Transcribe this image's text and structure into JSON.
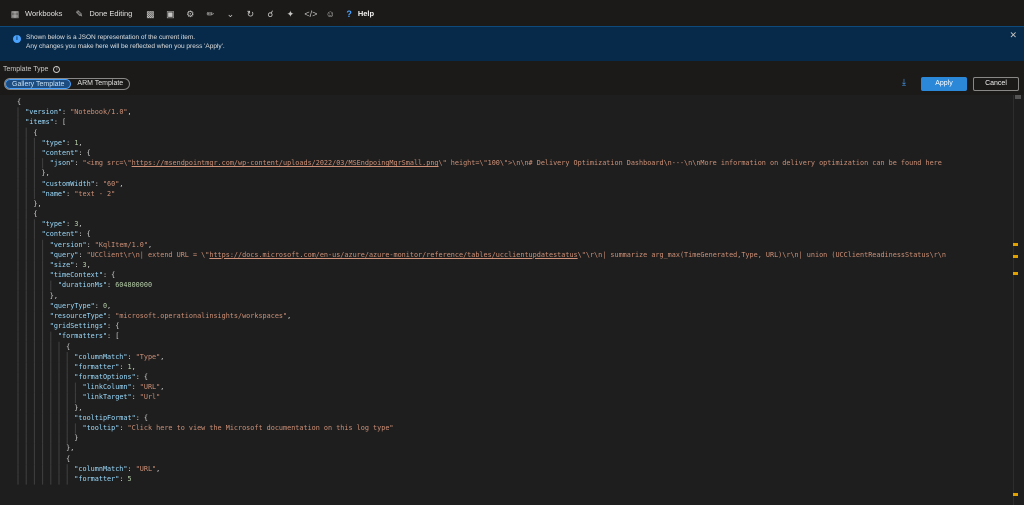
{
  "toolbar": {
    "workbooks_label": "Workbooks",
    "done_editing_label": "Done Editing",
    "help_label": "Help"
  },
  "banner": {
    "line1": "Shown below is a JSON representation of the current item.",
    "line2": "Any changes you make here will be reflected when you press 'Apply'."
  },
  "template_type": {
    "label": "Template Type",
    "options": [
      "Gallery Template",
      "ARM Template"
    ],
    "selected": "Gallery Template"
  },
  "actions": {
    "apply": "Apply",
    "cancel": "Cancel"
  },
  "editor": {
    "lines": [
      [
        [
          "p",
          "{"
        ]
      ],
      [
        [
          "p",
          "  "
        ],
        [
          "k",
          "\"version\""
        ],
        [
          "p",
          ": "
        ],
        [
          "s",
          "\"Notebook/1.0\""
        ],
        [
          "p",
          ","
        ]
      ],
      [
        [
          "p",
          "  "
        ],
        [
          "k",
          "\"items\""
        ],
        [
          "p",
          ": ["
        ]
      ],
      [
        [
          "p",
          "    {"
        ]
      ],
      [
        [
          "p",
          "      "
        ],
        [
          "k",
          "\"type\""
        ],
        [
          "p",
          ": "
        ],
        [
          "n",
          "1"
        ],
        [
          "p",
          ","
        ]
      ],
      [
        [
          "p",
          "      "
        ],
        [
          "k",
          "\"content\""
        ],
        [
          "p",
          ": {"
        ]
      ],
      [
        [
          "p",
          "        "
        ],
        [
          "k",
          "\"json\""
        ],
        [
          "p",
          ": "
        ],
        [
          "s",
          "\"<img src=\\\""
        ],
        [
          "u",
          "https://msendpointmgr.com/wp-content/uploads/2022/03/MSEndpoingMgrSmall.png"
        ],
        [
          "s",
          "\\\" height=\\\"100\\\">\\n\\n# Delivery Optimization Dashboard\\n---\\n\\nMore information on delivery optimization can be found here"
        ]
      ],
      [
        [
          "p",
          "      },"
        ]
      ],
      [
        [
          "p",
          "      "
        ],
        [
          "k",
          "\"customWidth\""
        ],
        [
          "p",
          ": "
        ],
        [
          "s",
          "\"60\""
        ],
        [
          "p",
          ","
        ]
      ],
      [
        [
          "p",
          "      "
        ],
        [
          "k",
          "\"name\""
        ],
        [
          "p",
          ": "
        ],
        [
          "s",
          "\"text - 2\""
        ]
      ],
      [
        [
          "p",
          "    },"
        ]
      ],
      [
        [
          "p",
          "    {"
        ]
      ],
      [
        [
          "p",
          "      "
        ],
        [
          "k",
          "\"type\""
        ],
        [
          "p",
          ": "
        ],
        [
          "n",
          "3"
        ],
        [
          "p",
          ","
        ]
      ],
      [
        [
          "p",
          "      "
        ],
        [
          "k",
          "\"content\""
        ],
        [
          "p",
          ": {"
        ]
      ],
      [
        [
          "p",
          "        "
        ],
        [
          "k",
          "\"version\""
        ],
        [
          "p",
          ": "
        ],
        [
          "s",
          "\"KqlItem/1.0\""
        ],
        [
          "p",
          ","
        ]
      ],
      [
        [
          "p",
          "        "
        ],
        [
          "k",
          "\"query\""
        ],
        [
          "p",
          ": "
        ],
        [
          "s",
          "\"UCClient\\r\\n| extend URL = \\\""
        ],
        [
          "u",
          "https://docs.microsoft.com/en-us/azure/azure-monitor/reference/tables/ucclientupdatestatus"
        ],
        [
          "s",
          "\\\"\\r\\n| summarize arg_max(TimeGenerated,Type, URL)\\r\\n| union (UCClientReadinessStatus\\r\\n"
        ]
      ],
      [
        [
          "p",
          "        "
        ],
        [
          "k",
          "\"size\""
        ],
        [
          "p",
          ": "
        ],
        [
          "n",
          "3"
        ],
        [
          "p",
          ","
        ]
      ],
      [
        [
          "p",
          "        "
        ],
        [
          "k",
          "\"timeContext\""
        ],
        [
          "p",
          ": {"
        ]
      ],
      [
        [
          "p",
          "          "
        ],
        [
          "k",
          "\"durationMs\""
        ],
        [
          "p",
          ": "
        ],
        [
          "n",
          "604800000"
        ]
      ],
      [
        [
          "p",
          "        },"
        ]
      ],
      [
        [
          "p",
          "        "
        ],
        [
          "k",
          "\"queryType\""
        ],
        [
          "p",
          ": "
        ],
        [
          "n",
          "0"
        ],
        [
          "p",
          ","
        ]
      ],
      [
        [
          "p",
          "        "
        ],
        [
          "k",
          "\"resourceType\""
        ],
        [
          "p",
          ": "
        ],
        [
          "s",
          "\"microsoft.operationalinsights/workspaces\""
        ],
        [
          "p",
          ","
        ]
      ],
      [
        [
          "p",
          "        "
        ],
        [
          "k",
          "\"gridSettings\""
        ],
        [
          "p",
          ": {"
        ]
      ],
      [
        [
          "p",
          "          "
        ],
        [
          "k",
          "\"formatters\""
        ],
        [
          "p",
          ": ["
        ]
      ],
      [
        [
          "p",
          "            {"
        ]
      ],
      [
        [
          "p",
          "              "
        ],
        [
          "k",
          "\"columnMatch\""
        ],
        [
          "p",
          ": "
        ],
        [
          "s",
          "\"Type\""
        ],
        [
          "p",
          ","
        ]
      ],
      [
        [
          "p",
          "              "
        ],
        [
          "k",
          "\"formatter\""
        ],
        [
          "p",
          ": "
        ],
        [
          "n",
          "1"
        ],
        [
          "p",
          ","
        ]
      ],
      [
        [
          "p",
          "              "
        ],
        [
          "k",
          "\"formatOptions\""
        ],
        [
          "p",
          ": {"
        ]
      ],
      [
        [
          "p",
          "                "
        ],
        [
          "k",
          "\"linkColumn\""
        ],
        [
          "p",
          ": "
        ],
        [
          "s",
          "\"URL\""
        ],
        [
          "p",
          ","
        ]
      ],
      [
        [
          "p",
          "                "
        ],
        [
          "k",
          "\"linkTarget\""
        ],
        [
          "p",
          ": "
        ],
        [
          "s",
          "\"Url\""
        ]
      ],
      [
        [
          "p",
          "              },"
        ]
      ],
      [
        [
          "p",
          "              "
        ],
        [
          "k",
          "\"tooltipFormat\""
        ],
        [
          "p",
          ": {"
        ]
      ],
      [
        [
          "p",
          "                "
        ],
        [
          "k",
          "\"tooltip\""
        ],
        [
          "p",
          ": "
        ],
        [
          "s",
          "\"Click here to view the Microsoft documentation on this log type\""
        ]
      ],
      [
        [
          "p",
          "              }"
        ]
      ],
      [
        [
          "p",
          "            },"
        ]
      ],
      [
        [
          "p",
          "            {"
        ]
      ],
      [
        [
          "p",
          "              "
        ],
        [
          "k",
          "\"columnMatch\""
        ],
        [
          "p",
          ": "
        ],
        [
          "s",
          "\"URL\""
        ],
        [
          "p",
          ","
        ]
      ],
      [
        [
          "p",
          "              "
        ],
        [
          "k",
          "\"formatter\""
        ],
        [
          "p",
          ": "
        ],
        [
          "n",
          "5"
        ]
      ]
    ]
  },
  "colors": {
    "key": "#9cdcfe",
    "string": "#ce9178",
    "number": "#b5cea8",
    "accent": "#2b88d8",
    "banner": "#072a4a"
  }
}
